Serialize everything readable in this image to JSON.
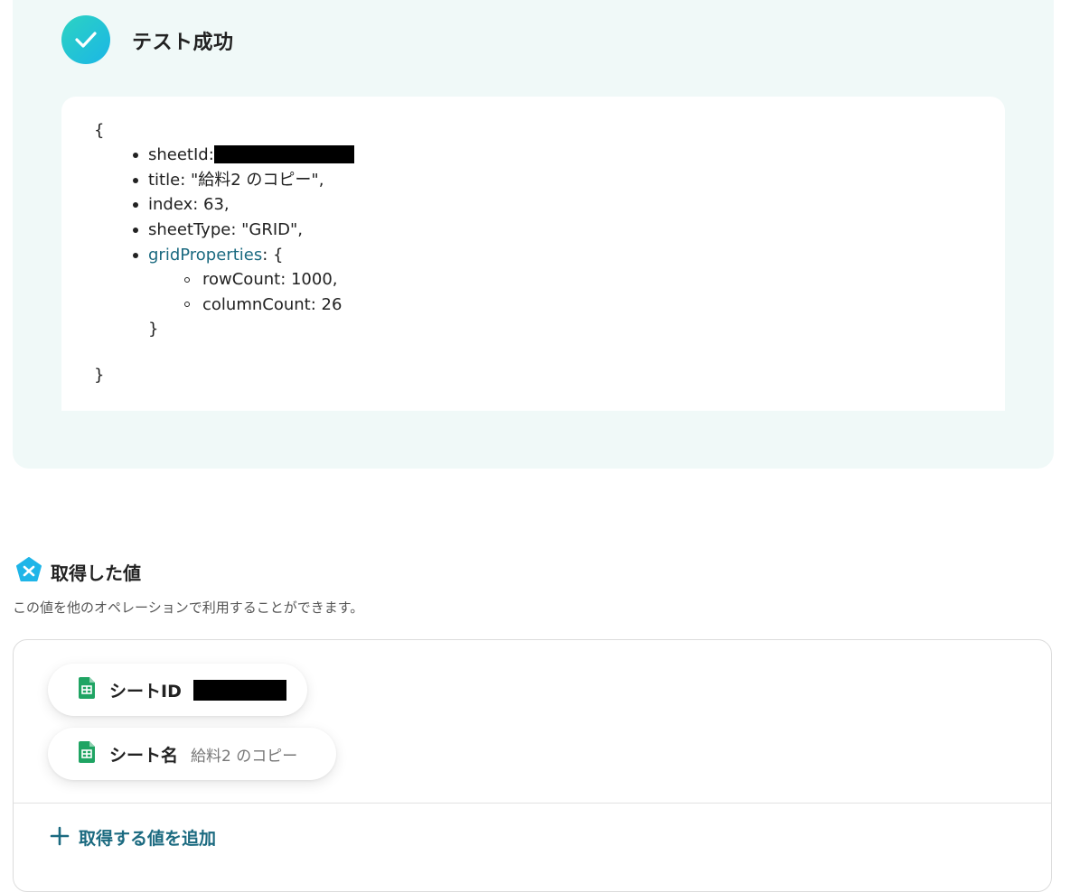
{
  "test_result": {
    "status_title": "テスト成功",
    "open_brace": "{",
    "close_brace": "}",
    "fields": {
      "sheet_id_key": "sheetId:",
      "title_line": "title: \"給料2 のコピー\",",
      "index_line": "index: 63,",
      "sheet_type_line": "sheetType: \"GRID\",",
      "grid_properties_key": "gridProperties",
      "grid_properties_open": ": {",
      "row_count_line": "rowCount: 1000,",
      "column_count_line": "columnCount: 26",
      "grid_properties_close": "}"
    }
  },
  "acquired_values": {
    "title": "取得した値",
    "description": "この値を他のオペレーションで利用することができます。",
    "items": [
      {
        "label": "シートID",
        "value": "",
        "redacted": true,
        "icon": "google-sheets-icon"
      },
      {
        "label": "シート名",
        "value": "給料2 のコピー",
        "redacted": false,
        "icon": "google-sheets-icon"
      }
    ],
    "add_button_label": "取得する値を追加"
  },
  "colors": {
    "panel_bg": "#f0f9f8",
    "accent_teal": "#1b6a80",
    "check_gradient_start": "#2cd3c2",
    "check_gradient_end": "#1bb6e6",
    "sheets_green": "#1fa463"
  }
}
